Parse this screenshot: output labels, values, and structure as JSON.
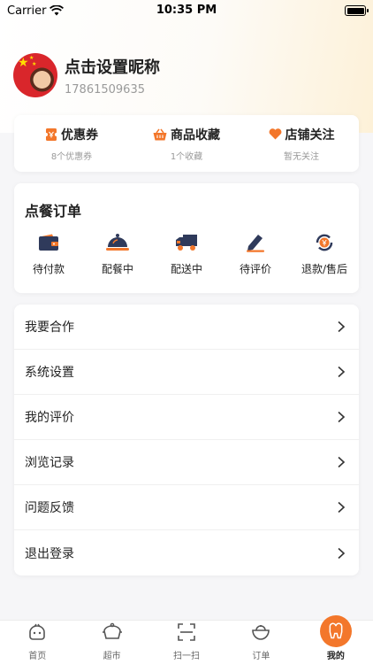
{
  "status_bar": {
    "carrier": "Carrier",
    "time": "10:35 PM"
  },
  "profile": {
    "nickname": "点击设置昵称",
    "phone": "17861509635"
  },
  "stats": [
    {
      "label": "优惠券",
      "sub": "8个优惠券",
      "icon": "coupon-icon"
    },
    {
      "label": "商品收藏",
      "sub": "1个收藏",
      "icon": "basket-icon"
    },
    {
      "label": "店铺关注",
      "sub": "暂无关注",
      "icon": "heart-icon"
    }
  ],
  "orders": {
    "title": "点餐订单",
    "items": [
      {
        "label": "待付款",
        "icon": "wallet-icon"
      },
      {
        "label": "配餐中",
        "icon": "cloche-icon"
      },
      {
        "label": "配送中",
        "icon": "truck-icon"
      },
      {
        "label": "待评价",
        "icon": "pencil-icon"
      },
      {
        "label": "退款/售后",
        "icon": "refund-icon"
      }
    ]
  },
  "menu": [
    {
      "label": "我要合作"
    },
    {
      "label": "系统设置"
    },
    {
      "label": "我的评价"
    },
    {
      "label": "浏览记录"
    },
    {
      "label": "问题反馈"
    },
    {
      "label": "退出登录"
    }
  ],
  "tabs": [
    {
      "label": "首页",
      "icon": "home-face-icon"
    },
    {
      "label": "超市",
      "icon": "supermarket-icon"
    },
    {
      "label": "扫一扫",
      "icon": "scan-icon"
    },
    {
      "label": "订单",
      "icon": "order-bowl-icon"
    },
    {
      "label": "我的",
      "icon": "profile-tooth-icon",
      "active": true
    }
  ],
  "colors": {
    "accent": "#f3772b",
    "navy": "#2f3a5b",
    "text": "#222222",
    "muted": "#9a9a9a"
  }
}
